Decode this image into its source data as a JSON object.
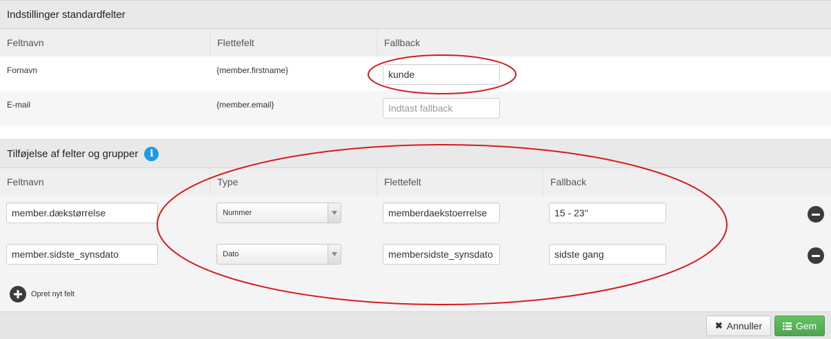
{
  "standard_fields": {
    "title": "Indstillinger standardfelter",
    "columns": {
      "name": "Feltnavn",
      "merge": "Flettefelt",
      "fallback": "Fallback"
    },
    "rows": [
      {
        "name": "Fornavn",
        "merge": "{member.firstname}",
        "fallback_value": "kunde",
        "fallback_placeholder": ""
      },
      {
        "name": "E-mail",
        "merge": "{member.email}",
        "fallback_value": "",
        "fallback_placeholder": "Indtast fallback"
      }
    ]
  },
  "custom_fields": {
    "title": "Tilføjelse af felter og grupper",
    "info_icon": "info-icon",
    "columns": {
      "name": "Feltnavn",
      "type": "Type",
      "merge": "Flettefelt",
      "fallback": "Fallback"
    },
    "rows": [
      {
        "name": "member.dækstørrelse",
        "type": "Nummer",
        "merge": "memberdaekstoerrelse",
        "fallback": "15 - 23''"
      },
      {
        "name": "member.sidste_synsdato",
        "type": "Dato",
        "merge": "membersidste_synsdato",
        "fallback": "sidste gang"
      }
    ],
    "add_label": "Opret nyt felt"
  },
  "footer": {
    "cancel_label": "Annuller",
    "save_label": "Gem"
  },
  "colors": {
    "annotation": "#d9191c",
    "info": "#1e9be0",
    "success": "#5bb75b"
  }
}
